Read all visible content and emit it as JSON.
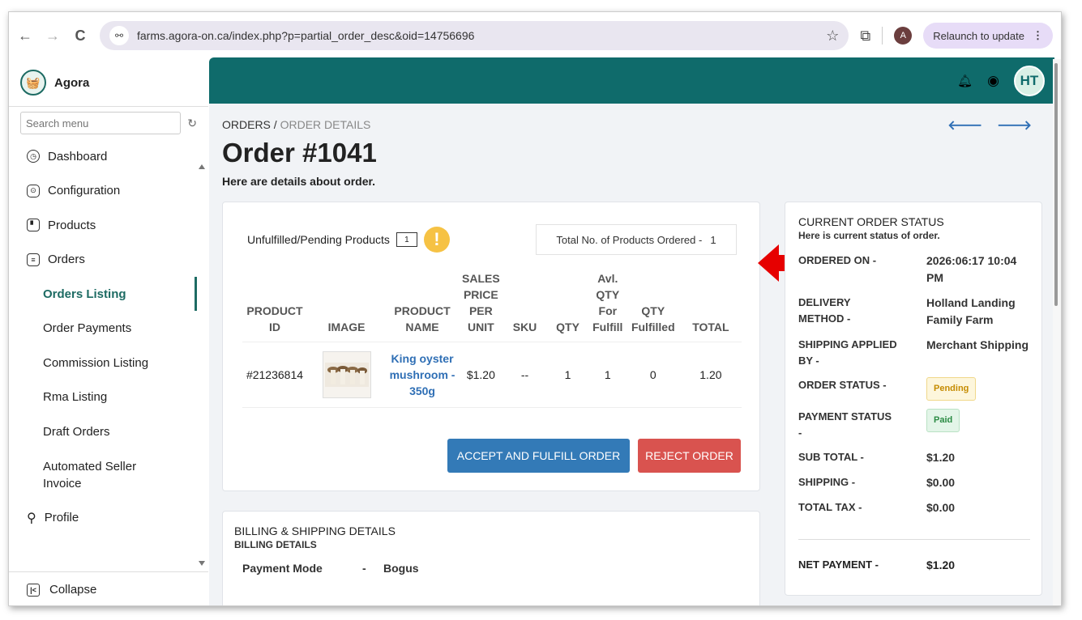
{
  "browser": {
    "back": "←",
    "forward": "→",
    "reload": "C",
    "site_info": "⚯",
    "url": "farms.agora-on.ca/index.php?p=partial_order_desc&oid=14756696",
    "profile_initial": "A",
    "relaunch_label": "Relaunch to update",
    "relaunch_menu": "⋮"
  },
  "brand": {
    "name": "Agora"
  },
  "sidebar": {
    "search_placeholder": "Search menu",
    "items": [
      {
        "label": "Dashboard",
        "icon": "dashboard-icon"
      },
      {
        "label": "Configuration",
        "icon": "configuration-icon"
      },
      {
        "label": "Products",
        "icon": "products-icon"
      },
      {
        "label": "Orders",
        "icon": "orders-icon"
      }
    ],
    "sub_items": [
      {
        "label": "Orders Listing",
        "active": true
      },
      {
        "label": "Order Payments"
      },
      {
        "label": "Commission Listing"
      },
      {
        "label": "Rma Listing"
      },
      {
        "label": "Draft Orders"
      },
      {
        "label": "Automated Seller Invoice"
      }
    ],
    "profile_label": "Profile",
    "collapse_label": "Collapse"
  },
  "topbar": {
    "avatar_initials": "HT"
  },
  "breadcrumb": {
    "root": "ORDERS",
    "separator": " / ",
    "current": "ORDER DETAILS"
  },
  "page": {
    "title": "Order #1041",
    "subtitle": "Here are details about order."
  },
  "products_card": {
    "unfulfilled_label": "Unfulfilled/Pending Products",
    "unfulfilled_count": "1",
    "total_label": "Total No. of Products Ordered -",
    "total_value": "1",
    "columns": [
      "PRODUCT ID",
      "IMAGE",
      "PRODUCT NAME",
      "SALES PRICE PER UNIT",
      "SKU",
      "QTY",
      "Avl. QTY For Fulfill",
      "QTY Fulfilled",
      "TOTAL"
    ],
    "rows": [
      {
        "product_id": "#21236814",
        "name": "King oyster mushroom - 350g",
        "price": "$1.20",
        "sku": "--",
        "qty": "1",
        "avl_qty": "1",
        "fulfilled": "0",
        "total": "1.20"
      }
    ],
    "accept_label": "ACCEPT AND FULFILL ORDER",
    "reject_label": "REJECT ORDER"
  },
  "status_card": {
    "title": "CURRENT ORDER STATUS",
    "subtitle": "Here is current status of order.",
    "ordered_on_label": "ORDERED ON -",
    "ordered_on_value": "2026:06:17 10:04 PM",
    "delivery_label": "DELIVERY METHOD -",
    "delivery_value": "Holland Landing Family Farm",
    "shipping_applied_label": "SHIPPING APPLIED BY -",
    "shipping_applied_value": "Merchant Shipping",
    "order_status_label": "ORDER STATUS -",
    "order_status_value": "Pending",
    "payment_status_label": "PAYMENT STATUS -",
    "payment_status_value": "Paid",
    "sub_total_label": "SUB TOTAL -",
    "sub_total_value": "$1.20",
    "shipping_label": "SHIPPING -",
    "shipping_value": "$0.00",
    "tax_label": "TOTAL TAX -",
    "tax_value": "$0.00",
    "net_label": "NET PAYMENT -",
    "net_value": "$1.20"
  },
  "billing_card": {
    "title": "BILLING & SHIPPING DETAILS",
    "subtitle": "BILLING DETAILS",
    "payment_mode_label": "Payment Mode",
    "dash": "-",
    "payment_mode_value": "Bogus"
  },
  "colors": {
    "teal": "#0f6b6b",
    "accept_blue": "#337ab7",
    "reject_red": "#d9534f",
    "link_blue": "#2f6fb5",
    "annotation_arrow": "#e60000"
  }
}
